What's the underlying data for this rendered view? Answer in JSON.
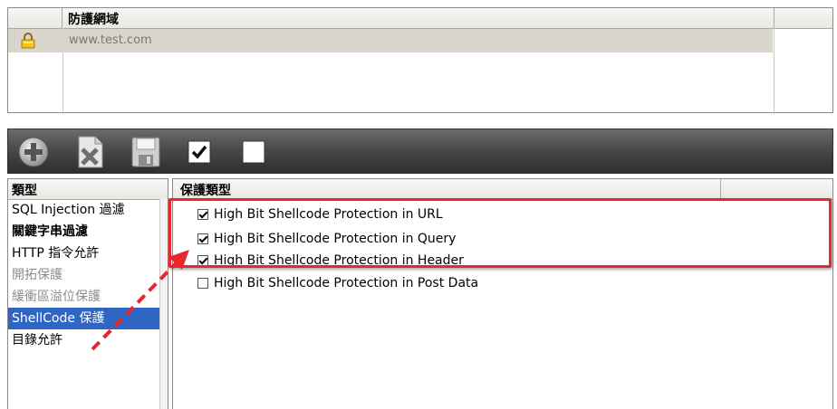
{
  "domains": {
    "header": "防護網域",
    "rows": [
      {
        "icon": "lock-icon",
        "domain": "www.test.com"
      }
    ]
  },
  "toolbar": {
    "buttons": [
      "add-icon",
      "delete-icon",
      "save-icon",
      "check-all-icon",
      "uncheck-all-icon"
    ]
  },
  "types": {
    "header": "類型",
    "items": [
      {
        "label": "SQL Injection 過濾",
        "state": "normal"
      },
      {
        "label": "關鍵字串過濾",
        "state": "bold"
      },
      {
        "label": "HTTP 指令允許",
        "state": "normal"
      },
      {
        "label": "開拓保護",
        "state": "disabled"
      },
      {
        "label": "緩衝區溢位保護",
        "state": "disabled"
      },
      {
        "label": "ShellCode 保護",
        "state": "selected"
      },
      {
        "label": "目錄允許",
        "state": "normal"
      }
    ]
  },
  "protection": {
    "header": "保護類型",
    "items": [
      {
        "label": "High Bit Shellcode Protection in URL",
        "checked": true
      },
      {
        "label": "High Bit Shellcode Protection in Query",
        "checked": true
      },
      {
        "label": "High Bit Shellcode Protection in Header",
        "checked": true
      },
      {
        "label": "High Bit Shellcode Protection in Post Data",
        "checked": false
      }
    ]
  },
  "colors": {
    "highlight": "#e8262b",
    "selection": "#2f66c6",
    "toolbar": "#4a4a4a"
  }
}
